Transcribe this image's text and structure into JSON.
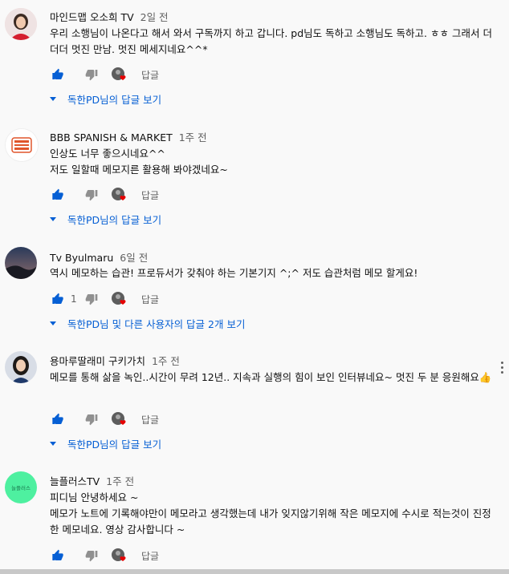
{
  "comments": [
    {
      "author": "마인드맵 오소희 TV",
      "time": "2일 전",
      "text": "우리 소행님이 나온다고 해서 와서 구독까지 하고 갑니다. pd님도 독하고 소행님도 독하고. ㅎㅎ 그래서 더더더 멋진 만남. 멋진 메세지네요^^*",
      "likes": "",
      "reply_label": "답글",
      "replies_link": "독한PD님의 답글 보기"
    },
    {
      "author": "BBB SPANISH & MARKET",
      "time": "1주 전",
      "text": "인상도 너무 좋으시네요^^\n저도 일할때 메모지른 활용해 봐야겠네요~",
      "likes": "",
      "reply_label": "답글",
      "replies_link": "독한PD님의 답글 보기"
    },
    {
      "author": "Tv Byulmaru",
      "time": "6일 전",
      "text": "역시 메모하는 습관! 프로듀서가 갖춰야 하는 기본기지 ^;^ 저도 습관처럼 메모 할게요!",
      "likes": "1",
      "reply_label": "답글",
      "replies_link": "독한PD님 및 다른 사용자의 답글 2개 보기"
    },
    {
      "author": "용마루딸래미 구키가치",
      "time": "1주 전",
      "text": "메모를 통해 삶을 녹인..시간이 무려 12년.. 지속과 실행의 힘이 보인 인터뷰네요~ 멋진 두 분 응원해요👍",
      "likes": "",
      "reply_label": "답글",
      "replies_link": "독한PD님의 답글 보기"
    },
    {
      "author": "늘플러스TV",
      "time": "1주 전",
      "text": "피디님 안녕하세요 ~\n메모가 노트에 기록해야만이 메모라고 생각했는데 내가 잊지않기위해 작은 메모지에 수시로 적는것이 진정한 메모네요. 영상 감사합니다 ~",
      "likes": "",
      "reply_label": "답글",
      "replies_link": ""
    }
  ],
  "avatar_text": {
    "bbb": "BBB SPANISH & MARKET",
    "neul": "늘플러스"
  },
  "colors": {
    "link": "#065fd4",
    "heart": "#e60000",
    "muted": "#606060",
    "neul_avatar": "#4ef0a0",
    "bbb_accent": "#e0552b"
  }
}
